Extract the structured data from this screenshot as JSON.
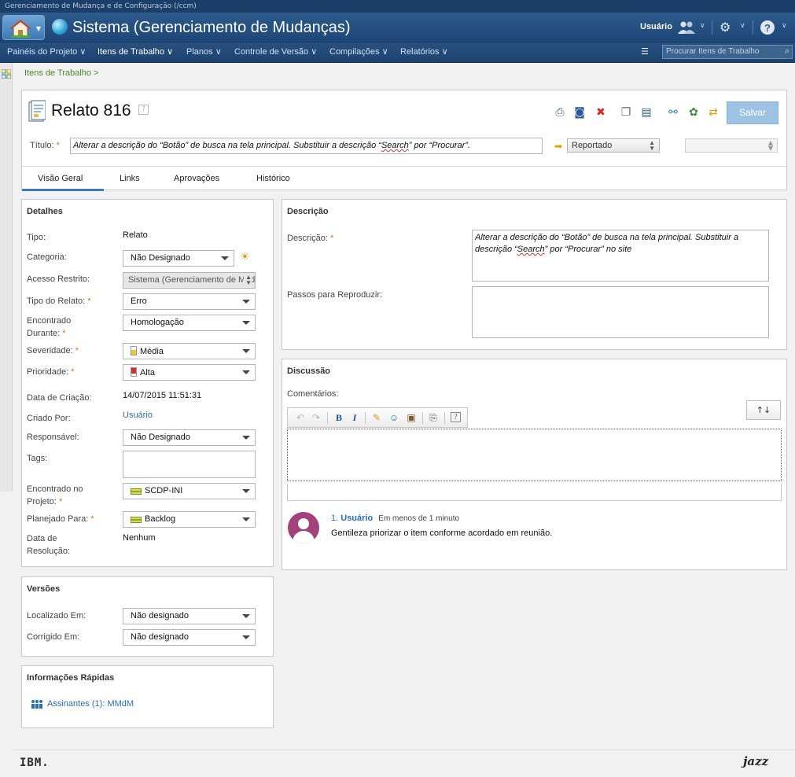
{
  "window": {
    "top_title": "Gerenciamento de Mudança e de Configuração (/ccm)"
  },
  "banner": {
    "app_title": "Sistema (Gerenciamento de Mudanças)",
    "user_label": "Usuário",
    "icons": [
      "home-icon",
      "globe-icon",
      "people-icon",
      "gear-icon",
      "help-icon"
    ]
  },
  "nav": {
    "items": [
      "Painéis do Projeto",
      "Itens de Trabalho",
      "Planos",
      "Controle de Versão",
      "Compilações",
      "Relatórios"
    ],
    "search_placeholder": "Procurar Itens de Trabalho"
  },
  "breadcrumb": "Itens de Trabalho >",
  "workitem": {
    "title": "Relato 816",
    "help": "?",
    "save_label": "Salvar",
    "title_label": "Título:",
    "required_mark": "*",
    "summary_before": "Alterar a descrição do “Botão” de busca na tela principal. Substituir a descrição “",
    "summary_word": "Search",
    "summary_after": "” por “Procurar”.",
    "state": "Reportado"
  },
  "tabs": [
    "Visão Geral",
    "Links",
    "Aprovações",
    "Histórico"
  ],
  "details": {
    "section_title": "Detalhes",
    "type_label": "Tipo:",
    "type_value": "Relato",
    "category_label": "Categoria:",
    "category_value": "Não Designado",
    "restricted_label": "Acesso Restrito:",
    "restricted_value": "Sistema (Gerenciamento de Mudanças)",
    "report_type_label": "Tipo do Relato:",
    "report_type_value": "Erro",
    "found_during_label1": "Encontrado",
    "found_during_label2": "Durante:",
    "found_during_value": "Homologação",
    "severity_label": "Severidade:",
    "severity_value": "Média",
    "priority_label": "Prioridade:",
    "priority_value": "Alta",
    "created_label": "Data de Criação:",
    "created_value": "14/07/2015 11:51:31",
    "created_by_label": "Criado Por:",
    "created_by_value": "Usuário",
    "owner_label": "Responsável:",
    "owner_value": "Não Designado",
    "tags_label": "Tags:",
    "found_in_label1": "Encontrado no",
    "found_in_label2": "Projeto:",
    "found_in_value": "SCDP-INI",
    "planned_label": "Planejado Para:",
    "planned_value": "Backlog",
    "resolution_label1": "Data de",
    "resolution_label2": "Resolução:",
    "resolution_value": "Nenhum"
  },
  "versions": {
    "section_title": "Versões",
    "found_label": "Localizado Em:",
    "found_value": "Não designado",
    "fixed_label": "Corrigido Em:",
    "fixed_value": "Não designado"
  },
  "quick_info": {
    "section_title": "Informações Rápidas",
    "subscribers": "Assinantes (1):",
    "subscriber_name": "MMdM"
  },
  "description": {
    "section_title": "Descrição",
    "label": "Descrição:",
    "text_before": "Alterar a descrição do “Botão” de busca na tela principal. Substituir a descrição “",
    "text_word": "Search",
    "text_after": "” por “Procurar” no site",
    "steps_label": "Passos para Reproduzir:"
  },
  "discussion": {
    "section_title": "Discussão",
    "comments_label": "Comentários:",
    "sort_label": "↑↓",
    "comment": {
      "number": "1.",
      "author": "Usuário",
      "time": "Em menos de 1 minuto",
      "text": "Gentileza priorizar o item conforme acordado em reunião."
    }
  },
  "footer": {
    "left_logo": "IBM.",
    "right_logo": "jazz"
  }
}
